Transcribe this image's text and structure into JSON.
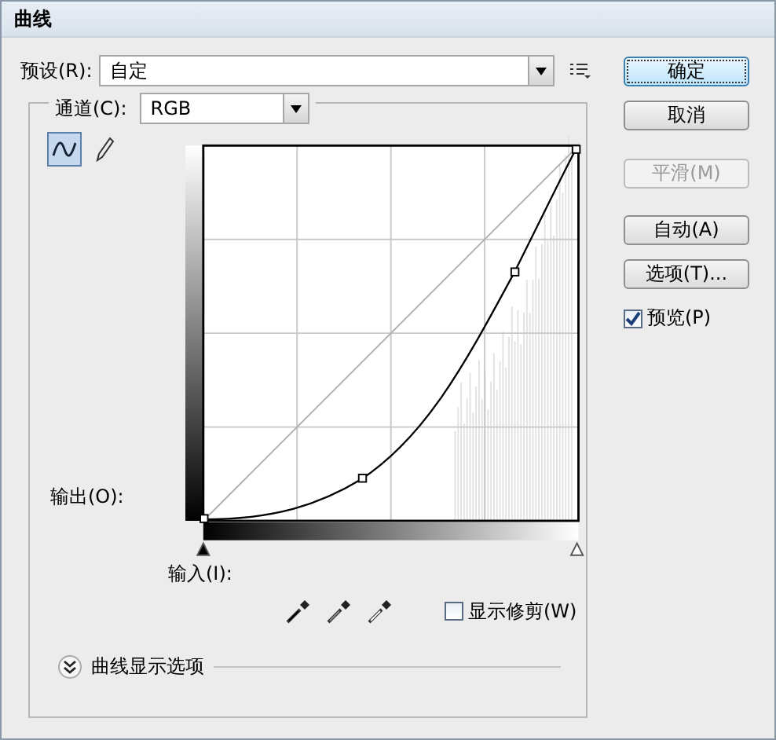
{
  "window": {
    "title": "曲线"
  },
  "preset": {
    "label": "预设(R):",
    "value": "自定"
  },
  "channel": {
    "label": "通道(C):",
    "value": "RGB"
  },
  "tools": [
    {
      "kind": "curve",
      "selected": true
    },
    {
      "kind": "pencil",
      "selected": false
    }
  ],
  "output_label": "输出(O):",
  "input_label": "输入(I):",
  "input_sliders": [
    {
      "kind": "shadow",
      "level": 0
    },
    {
      "kind": "highlight",
      "level": 1
    }
  ],
  "show_clipping": {
    "label": "显示修剪(W)",
    "checked": false
  },
  "curve_options": {
    "label": "曲线显示选项",
    "expanded": false
  },
  "buttons": [
    {
      "label": "确定",
      "disabled": false,
      "default": true
    },
    {
      "label": "取消",
      "disabled": false,
      "default": false
    },
    {
      "label": "平滑(M)",
      "disabled": true,
      "default": false
    },
    {
      "label": "自动(A)",
      "disabled": false,
      "default": false
    },
    {
      "label": "选项(T)...",
      "disabled": false,
      "default": false
    }
  ],
  "preview": {
    "label": "预览(P)",
    "checked": true
  }
}
